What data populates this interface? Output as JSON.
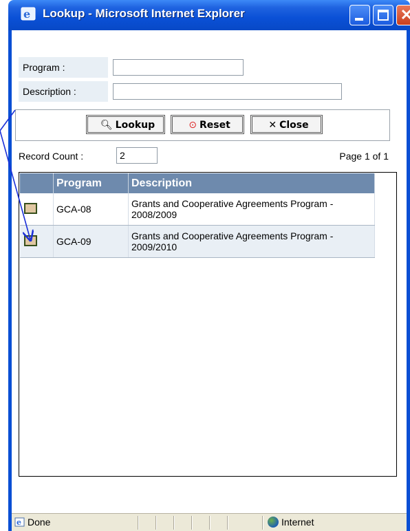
{
  "window": {
    "title": "Lookup - Microsoft Internet Explorer"
  },
  "form": {
    "program_label": "Program :",
    "program_value": "",
    "description_label": "Description :",
    "description_value": ""
  },
  "buttons": {
    "lookup": "Lookup",
    "reset": "Reset",
    "close": "Close"
  },
  "record": {
    "label": "Record Count :",
    "value": "2",
    "page": "Page 1 of 1"
  },
  "grid": {
    "columns": [
      "Program",
      "Description"
    ],
    "rows": [
      {
        "program": "GCA-08",
        "description": "Grants and Cooperative Agreements Program - 2008/2009"
      },
      {
        "program": "GCA-09",
        "description": "Grants and Cooperative Agreements Program - 2009/2010"
      }
    ]
  },
  "status": {
    "left": "Done",
    "zone": "Internet"
  },
  "colors": {
    "titlebar": "#0a50d6",
    "grid_header": "#6e8aad",
    "annotation_arrow": "#1a2fd8"
  }
}
